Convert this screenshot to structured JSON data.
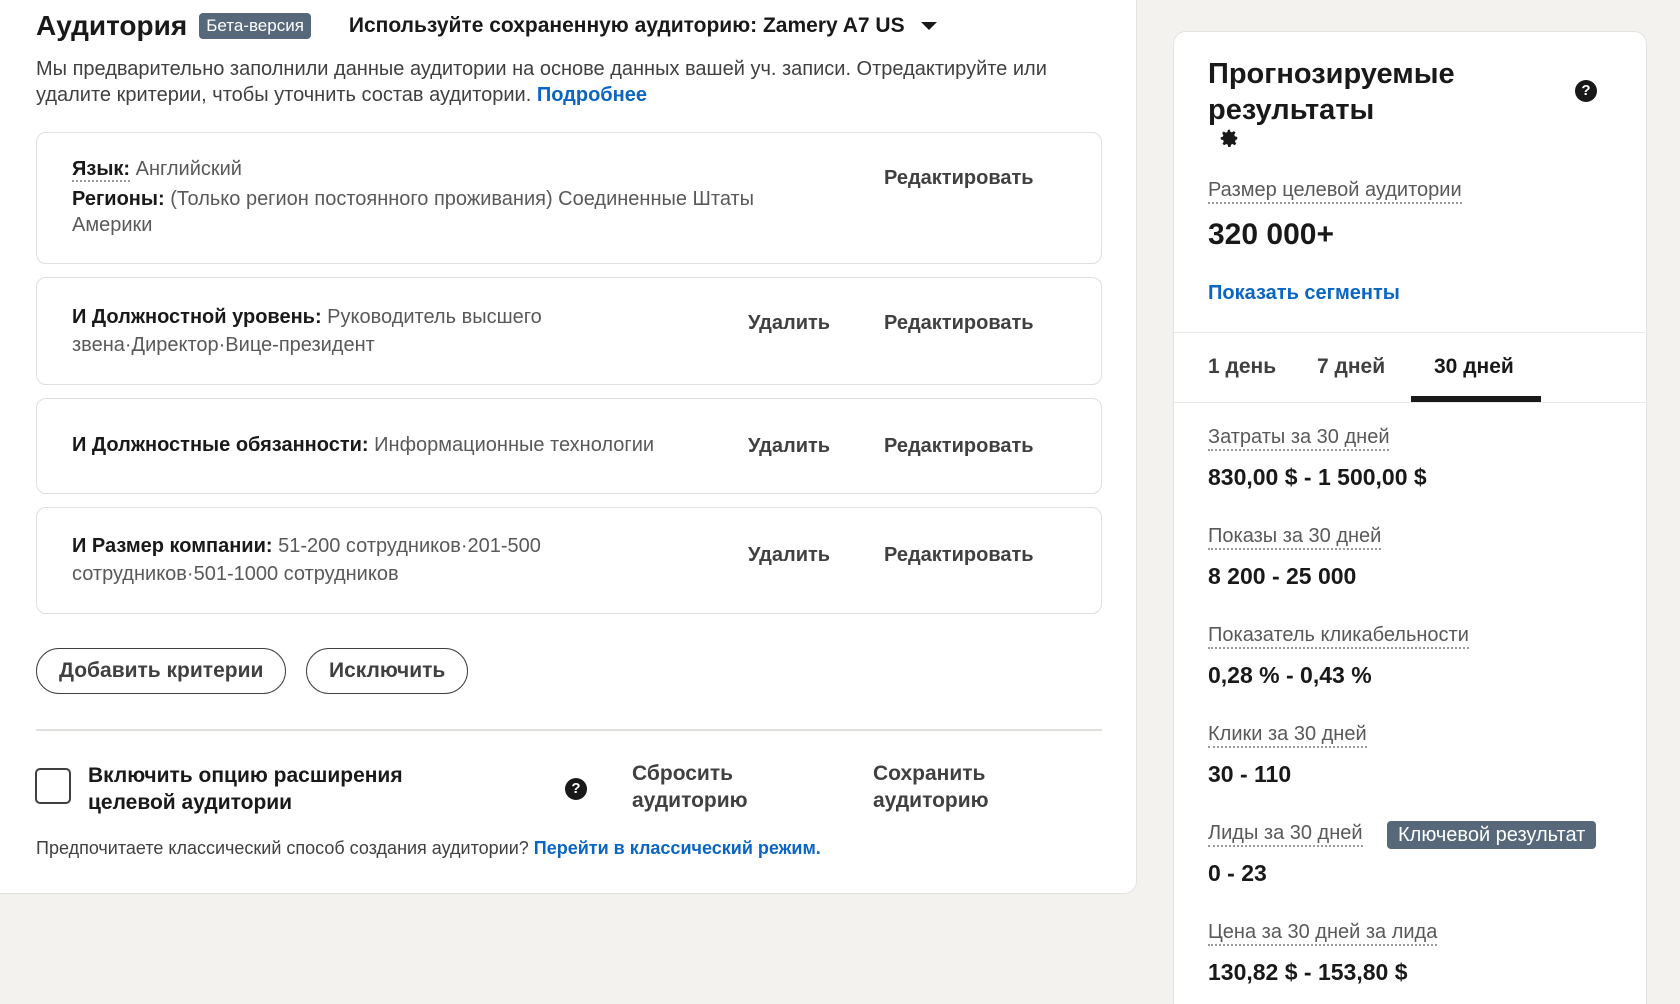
{
  "header": {
    "title": "Аудитория",
    "beta_badge": "Бета-версия",
    "saved_audience": "Используйте сохраненную аудиторию: Zamery A7 US"
  },
  "intro": {
    "text": "Мы предварительно заполнили данные аудитории на основе данных вашей уч. записи. Отредактируйте или удалите критерии, чтобы уточнить состав аудитории.",
    "link": "Подробнее"
  },
  "criteria": [
    {
      "label1": "Язык:",
      "value1": " Английский",
      "label2": "Регионы:",
      "value2": " (Только регион постоянного проживания) Соединенные Штаты Америки",
      "edit": "Редактировать"
    },
    {
      "label": "И Должностной уровень:",
      "value": " Руководитель высшего звена·Директор·Вице-президент",
      "delete": "Удалить",
      "edit": "Редактировать"
    },
    {
      "label": "И Должностные обязанности:",
      "value": " Информационные технологии",
      "delete": "Удалить",
      "edit": "Редактировать"
    },
    {
      "label": "И Размер компании:",
      "value": " 51-200 сотрудников·201-500 сотрудников·501-1000 сотрудников",
      "delete": "Удалить",
      "edit": "Редактировать"
    }
  ],
  "buttons": {
    "add_criteria": "Добавить критерии",
    "exclude": "Исключить",
    "expand_option": "Включить опцию расширения целевой аудитории",
    "reset": "Сбросить аудиторию",
    "save": "Сохранить аудиторию"
  },
  "classic": {
    "text": "Предпочитаете классический способ создания аудитории?",
    "link": "Перейти в классический режим."
  },
  "forecast": {
    "title": "Прогнозируемые результаты",
    "audience_size_label": "Размер целевой аудитории",
    "audience_size_value": "320 000+",
    "segments_link": "Показать сегменты",
    "tabs": [
      "1 день",
      "7 дней",
      "30 дней"
    ],
    "active_tab": "30 дней",
    "metrics": [
      {
        "label": "Затраты за 30 дней",
        "value": "830,00 $ - 1 500,00 $"
      },
      {
        "label": "Показы за 30 дней",
        "value": "8 200 - 25 000"
      },
      {
        "label": "Показатель кликабельности",
        "value": "0,28 % - 0,43 %"
      },
      {
        "label": "Клики за 30 дней",
        "value": "30 - 110"
      },
      {
        "label": "Лиды за 30 дней",
        "value": "0 - 23"
      },
      {
        "label": "Цена за 30 дней за лида",
        "value": "130,82 $ - 153,80 $"
      }
    ],
    "key_result_badge": "Ключевой результат"
  },
  "colors": {
    "link": "#0a66c2",
    "badge": "#56687a",
    "page_bg": "#f3f2ef"
  },
  "icons": {
    "help": "question-circle-icon",
    "settings": "gear-icon",
    "dropdown": "caret-down-icon"
  }
}
